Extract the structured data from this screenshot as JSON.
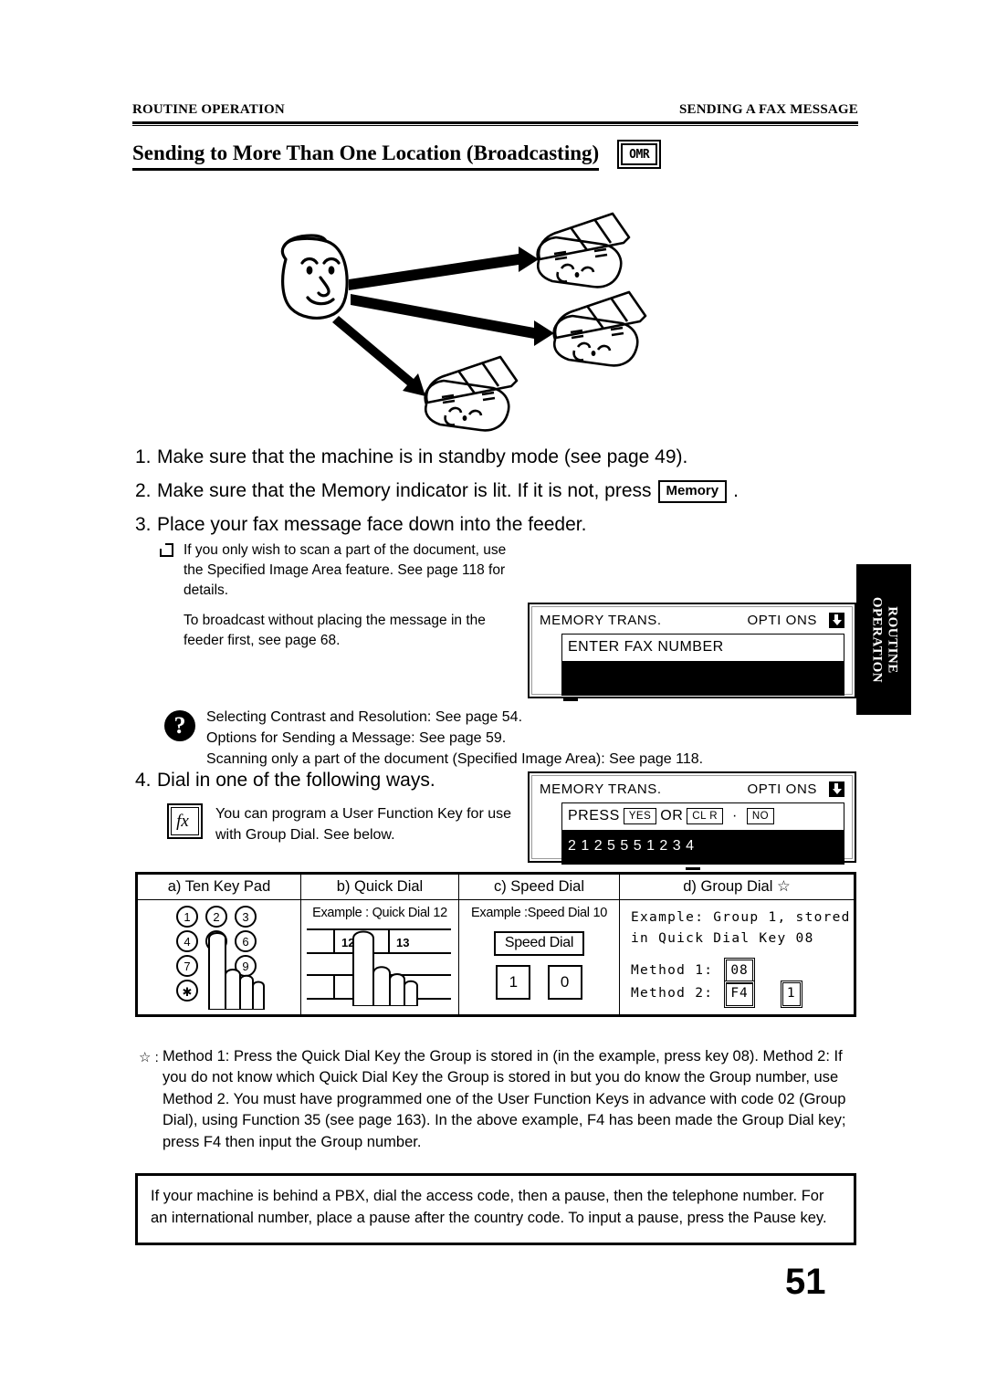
{
  "header": {
    "left": "ROUTINE OPERATION",
    "right": "SENDING A FAX MESSAGE"
  },
  "section": {
    "title": "Sending to More Than One Location (Broadcasting)",
    "badge": "OMR"
  },
  "illustration": {
    "caption": "Person broadcasting one fax message to three receiving fax machines",
    "receiver_count": 3
  },
  "steps": [
    {
      "num": "1.",
      "text": "Make sure that the machine is in standby mode (see page 49)."
    },
    {
      "num": "2.",
      "text_before": "Make sure that the Memory indicator is lit. If it is not, press",
      "key": "Memory",
      "text_after": "."
    },
    {
      "num": "3.",
      "text": "Place your fax message face down into the feeder."
    }
  ],
  "notes": [
    "If you only wish to scan a part of the document, use the Specified Image Area feature. See page 118 for details.",
    "To broadcast without placing the message in the feeder first, see page 68."
  ],
  "lcd_enter_fax": {
    "title": "MEMORY TRANS.",
    "options": "OPTI ONS",
    "arrow_icon": "down-arrow-icon",
    "line1": "ENTER FAX NUMBER",
    "line2": ""
  },
  "lcd_press_yes": {
    "title": "MEMORY TRANS.",
    "options": "OPTI ONS",
    "arrow_icon": "down-arrow-icon",
    "prompt_prefix": "PRESS",
    "key_yes": "YES",
    "prompt_or": "OR",
    "key_clr": "CL R",
    "prompt_dot": "·",
    "key_no": "NO",
    "number": "2 1 2 5 5 5 1 2 3 4"
  },
  "side_tab": {
    "line1": "ROUTINE",
    "line2": "OPERATION"
  },
  "question_callout": {
    "icon": "question-mark-icon",
    "lines": [
      "Selecting Contrast and Resolution: See page 54.",
      "Options for Sending a Message: See page 59.",
      "Scanning only a part of the document (Specified Image Area): See page 118."
    ]
  },
  "step4": {
    "num": "4.",
    "text": "Dial in one of the following ways.",
    "fx_key_label": "fx",
    "fx_text": "You can program a User Function Key for use with Group Dial. See below."
  },
  "dial_table": {
    "headers": [
      "a) Ten Key Pad",
      "b) Quick Dial",
      "c) Speed Dial",
      "d) Group Dial ☆"
    ],
    "ten_key_pad": {
      "keys": [
        "1",
        "2",
        "3",
        "4",
        "5",
        "6",
        "7",
        "9",
        "∗"
      ],
      "pressed_key": "5"
    },
    "quick_dial": {
      "example_label": "Example : Quick Dial 12",
      "key_left": "12",
      "key_right": "13"
    },
    "speed_dial": {
      "example_label": "Example :Speed Dial 10",
      "button_label": "Speed Dial",
      "digit1": "1",
      "digit2": "0"
    },
    "group_dial": {
      "line1": "Example: Group 1, stored",
      "line2": "in Quick Dial Key 08",
      "method1_label": "Method 1:",
      "method1_key": "08",
      "method2_label": "Method 2:",
      "method2_key1": "F4",
      "method2_key2": "1"
    }
  },
  "footnote": {
    "marker": "☆ :",
    "text": "Method 1: Press the Quick Dial Key the Group is stored in (in the example, press key 08). Method 2: If you do not know which Quick Dial Key the Group is stored in but you do know the Group number, use Method 2. You must have programmed one of the User Function Keys in advance with code 02 (Group Dial), using Function 35 (see page 163). In the above example, F4 has been made the Group Dial key; press F4 then input the Group number."
  },
  "bottom_note": {
    "text": "If your machine is behind a PBX, dial the access code, then a pause, then the telephone number. For an international number, place a pause after the country code. To input a pause, press the Pause key."
  },
  "page_number": "51"
}
